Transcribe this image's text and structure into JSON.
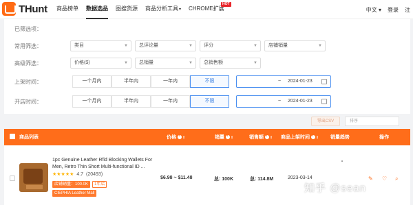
{
  "brand": {
    "name": "THunt",
    "accent": "#ff6d1a"
  },
  "nav": {
    "items": [
      {
        "label": "商品榜单",
        "active": false
      },
      {
        "label": "数据选品",
        "active": true
      },
      {
        "label": "图搜货源",
        "active": false
      },
      {
        "label": "商品分析工具",
        "active": false,
        "caret": "▾"
      },
      {
        "label": "CHROME扩展",
        "active": false,
        "badge": "HOT"
      }
    ],
    "language": "中文 ▾",
    "login": "登录",
    "register": "注"
  },
  "filters": {
    "selected_label": "已筛选项：",
    "common_label": "常用筛选：",
    "common": [
      "类目",
      "总评论量",
      "评分",
      "店铺销量"
    ],
    "advanced_label": "高级筛选：",
    "advanced": [
      "价格($)",
      "总销量",
      "总销售额"
    ],
    "listed_label": "上架时间：",
    "listed_options": [
      "一个月内",
      "半年内",
      "一年内",
      "不限"
    ],
    "listed_date_sep": "~",
    "listed_date_end": "2024-01-23",
    "opened_label": "开店时间：",
    "opened_options": [
      "一个月内",
      "半年内",
      "一年内",
      "不限"
    ],
    "opened_date_sep": "~",
    "opened_date_end": "2024-01-23"
  },
  "actions": {
    "export_label": "导出CSV",
    "sort_label": "排序"
  },
  "table": {
    "headers": {
      "list": "商品列表",
      "price": "价格",
      "sales": "销量",
      "revenue": "销售额",
      "listed": "商品上架时间",
      "trend": "销量趋势",
      "ops": "操作"
    },
    "row": {
      "title": "1pc Genuine Leather Rfid Blocking Wallets For Men, Retro Thin Short Multi-functional ID ...",
      "rating": "4.7",
      "reviews": "(20493)",
      "shop_sales_tag": "店铺销量：100.0K",
      "year_tag": "1年店",
      "shop_tag": "CIEPHIA Leather Mall",
      "price": "$6.98 ~ $11.48",
      "sales": "总: 100K",
      "revenue": "总: 114.8M",
      "listed": "2023-03-14"
    }
  },
  "watermark": "知乎 @sean"
}
